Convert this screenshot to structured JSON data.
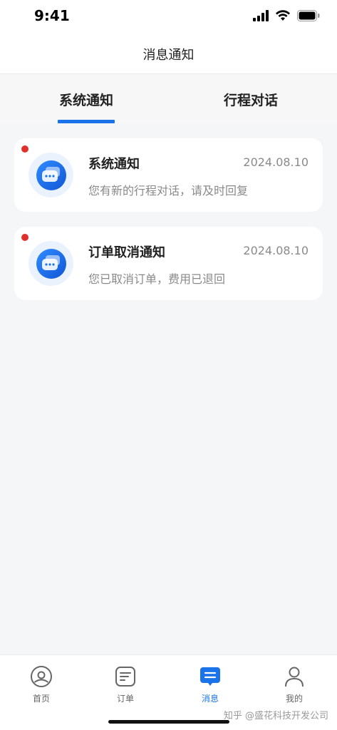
{
  "status_bar": {
    "time": "9:41"
  },
  "header": {
    "title": "消息通知"
  },
  "tabs": [
    {
      "label": "系统通知",
      "active": true
    },
    {
      "label": "行程对话",
      "active": false
    }
  ],
  "notifications": [
    {
      "title": "系统通知",
      "date": "2024.08.10",
      "desc": "您有新的行程对话，请及时回复",
      "unread": true,
      "icon": "chat-bubble-icon"
    },
    {
      "title": "订单取消通知",
      "date": "2024.08.10",
      "desc": "您已取消订单，费用已退回",
      "unread": true,
      "icon": "chat-bubble-icon"
    }
  ],
  "bottom_nav": [
    {
      "label": "首页",
      "icon": "home-icon",
      "active": false
    },
    {
      "label": "订单",
      "icon": "order-icon",
      "active": false
    },
    {
      "label": "消息",
      "icon": "message-icon",
      "active": true
    },
    {
      "label": "我的",
      "icon": "profile-icon",
      "active": false
    }
  ],
  "watermark": "知乎 @盛花科技开发公司",
  "colors": {
    "accent": "#1a73e8",
    "unread": "#e0302c",
    "muted": "#8a8a8a"
  }
}
